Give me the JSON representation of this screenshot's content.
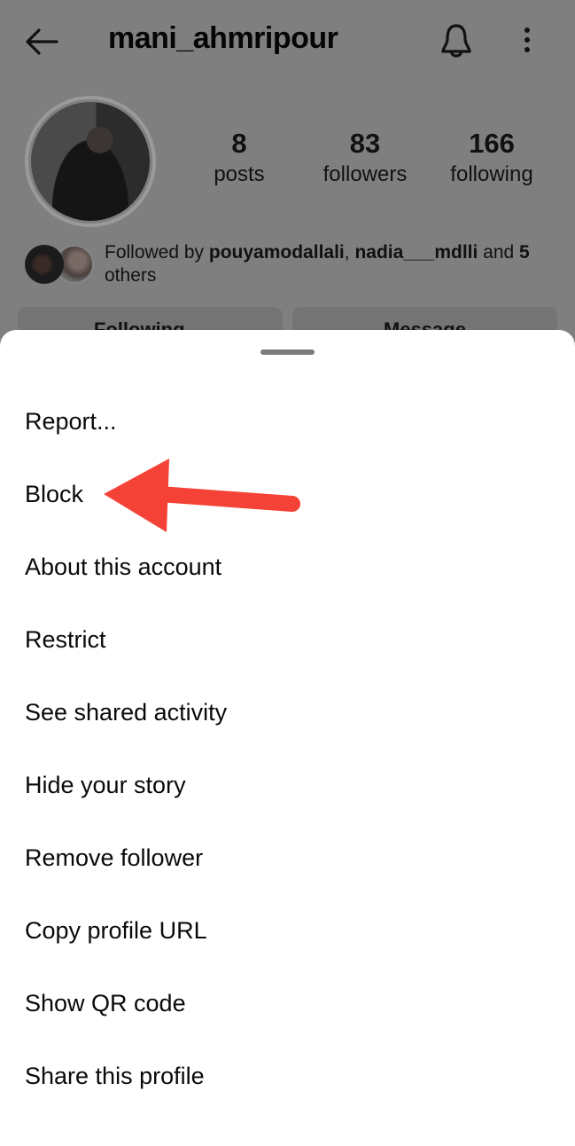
{
  "header": {
    "username": "mani_ahmripour",
    "back_icon": "arrow-left-icon",
    "notifications_icon": "bell-icon",
    "more_icon": "vertical-dots-icon"
  },
  "stats": [
    {
      "value": "8",
      "label": "posts"
    },
    {
      "value": "83",
      "label": "followers"
    },
    {
      "value": "166",
      "label": "following"
    }
  ],
  "followed_by": {
    "prefix": "Followed by ",
    "user1": "pouyamodallali",
    "sep": ", ",
    "user2": "nadia___mdlli",
    "middle": " and ",
    "count": "5",
    "suffix": " others"
  },
  "buttons": {
    "following": "Following ⌄",
    "message": "Message"
  },
  "sheet": {
    "menu_items": [
      "Report...",
      "Block",
      "About this account",
      "Restrict",
      "See shared activity",
      "Hide your story",
      "Remove follower",
      "Copy profile URL",
      "Show QR code",
      "Share this profile"
    ]
  },
  "annotation": {
    "arrow_color": "#F44336",
    "points_to": "Block"
  },
  "colors": {
    "overlay": "#7f7f7f",
    "sheet_bg": "#ffffff",
    "text": "#0a0a0a"
  }
}
